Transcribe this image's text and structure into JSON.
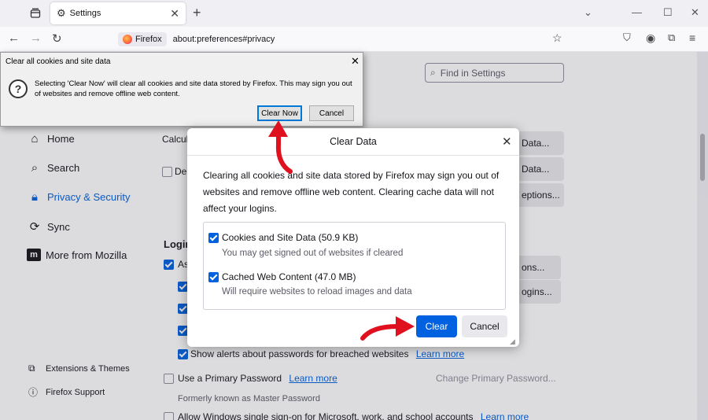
{
  "browser": {
    "tab_title": "Settings",
    "url_badge": "Firefox",
    "url": "about:preferences#privacy"
  },
  "sidebar": {
    "items": [
      {
        "label": "Home",
        "icon": "home-icon"
      },
      {
        "label": "Search",
        "icon": "search-icon"
      },
      {
        "label": "Privacy & Security",
        "icon": "lock-icon",
        "active": true
      },
      {
        "label": "Sync",
        "icon": "sync-icon"
      },
      {
        "label": "More from Mozilla",
        "icon": "mozilla-icon"
      }
    ],
    "bottom_items": [
      {
        "label": "Extensions & Themes",
        "icon": "puzzle-icon"
      },
      {
        "label": "Firefox Support",
        "icon": "help-icon"
      }
    ]
  },
  "settings": {
    "search_placeholder": "Find in Settings",
    "calc_partial": "Calcula",
    "del_partial": "Del",
    "logins_heading_partial": "Login",
    "ask_partial": "As",
    "btn_data_1": "Data...",
    "btn_data_2": "Data...",
    "btn_exceptions": "eptions...",
    "btn_exceptions_2": "ons...",
    "btn_logins": "ogins...",
    "breach_alerts": "Show alerts about passwords for breached websites",
    "learn_more": "Learn more",
    "primary_password": "Use a Primary Password",
    "change_primary": "Change Primary Password...",
    "formerly": "Formerly known as Master Password",
    "windows_sso": "Allow Windows single sign-on for Microsoft, work, and school accounts"
  },
  "confirm_dialog": {
    "title": "Clear all cookies and site data",
    "message": "Selecting 'Clear Now' will clear all cookies and site data stored by Firefox. This may sign you out of websites and remove offline web content.",
    "clear_now": "Clear Now",
    "cancel": "Cancel"
  },
  "clear_data_dialog": {
    "title": "Clear Data",
    "description": "Clearing all cookies and site data stored by Firefox may sign you out of websites and remove offline web content. Clearing cache data will not affect your logins.",
    "options": [
      {
        "label": "Cookies and Site Data (50.9 KB)",
        "sub": "You may get signed out of websites if cleared",
        "checked": true
      },
      {
        "label": "Cached Web Content (47.0 MB)",
        "sub": "Will require websites to reload images and data",
        "checked": true
      }
    ],
    "clear_button": "Clear",
    "cancel_button": "Cancel"
  },
  "colors": {
    "accent": "#0061e0",
    "annotation_arrow": "#e0111f"
  }
}
